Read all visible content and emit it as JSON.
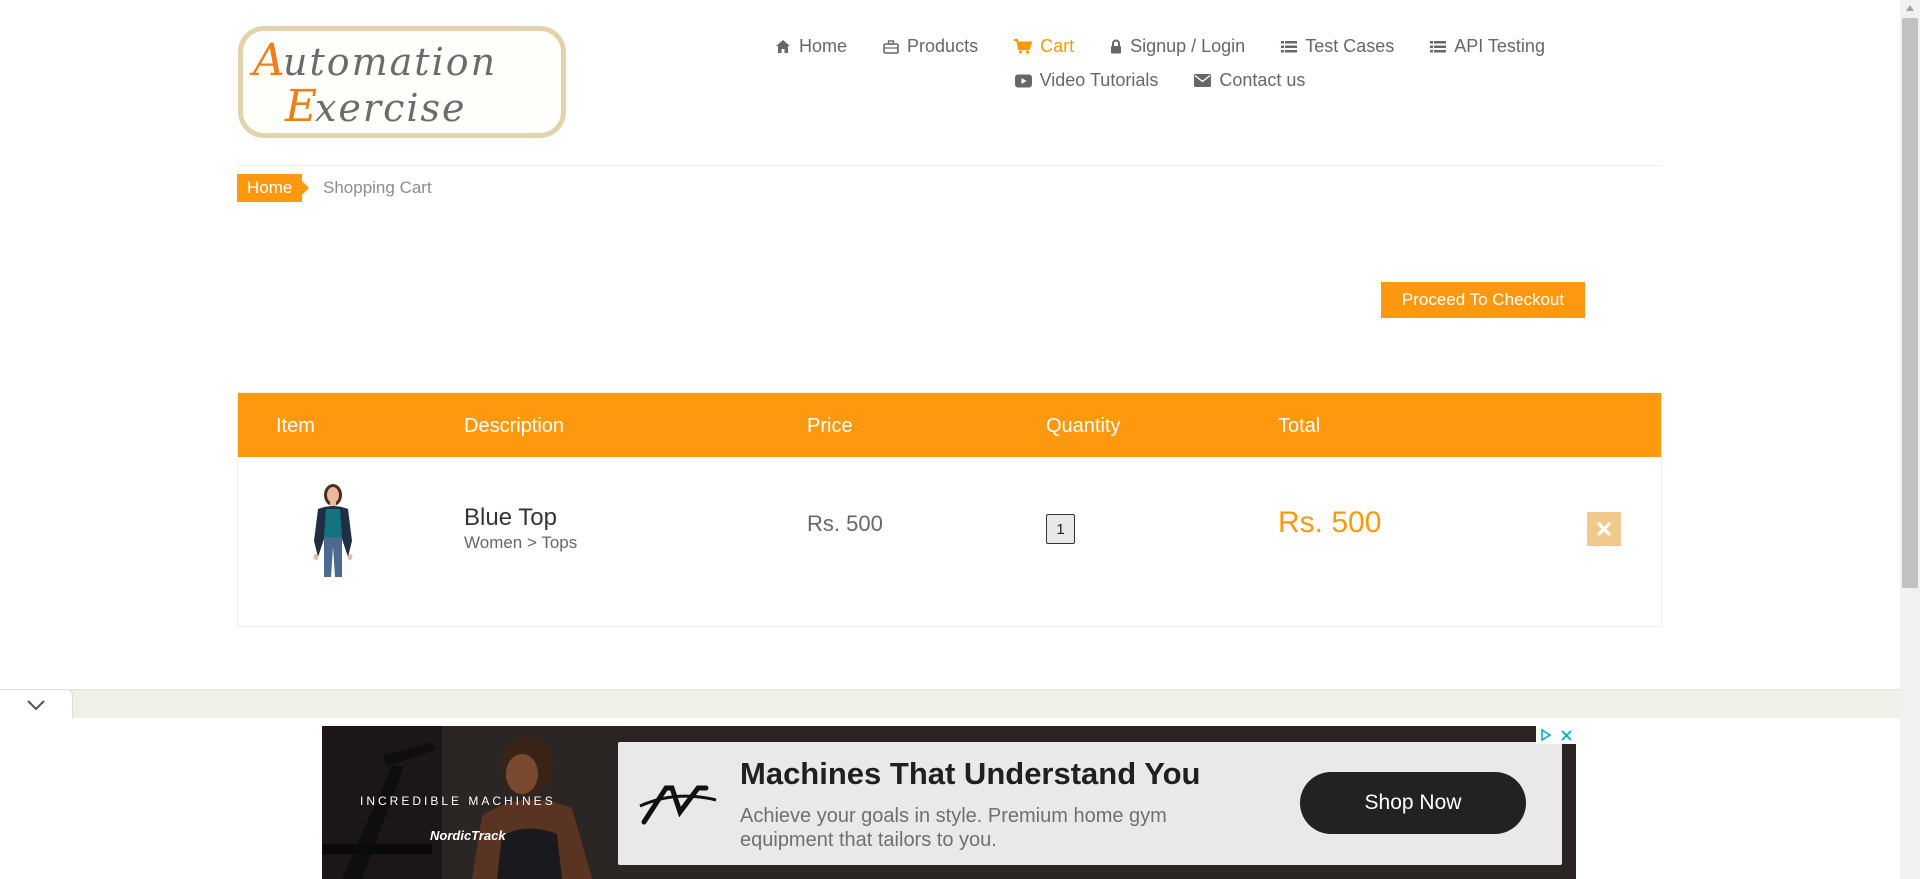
{
  "logo": {
    "line1": "Automation",
    "line2": "Exercise"
  },
  "nav": {
    "row1": [
      {
        "label": "Home",
        "icon": "home-icon"
      },
      {
        "label": "Products",
        "icon": "briefcase-icon"
      },
      {
        "label": "Cart",
        "icon": "cart-icon",
        "active": true
      },
      {
        "label": "Signup / Login",
        "icon": "lock-icon"
      },
      {
        "label": "Test Cases",
        "icon": "list-icon"
      },
      {
        "label": "API Testing",
        "icon": "list-icon"
      }
    ],
    "row2": [
      {
        "label": "Video Tutorials",
        "icon": "youtube-icon"
      },
      {
        "label": "Contact us",
        "icon": "envelope-icon"
      }
    ]
  },
  "breadcrumb": {
    "home": "Home",
    "current": "Shopping Cart"
  },
  "checkout_label": "Proceed To Checkout",
  "cart": {
    "headers": {
      "item": "Item",
      "description": "Description",
      "price": "Price",
      "quantity": "Quantity",
      "total": "Total"
    },
    "rows": [
      {
        "name": "Blue Top",
        "category": "Women > Tops",
        "price": "Rs. 500",
        "quantity": "1",
        "total": "Rs. 500"
      }
    ]
  },
  "ad": {
    "tagline": "INCREDIBLE MACHINES",
    "brand": "NordicTrack",
    "title": "Machines That Understand You",
    "description": "Achieve your goals in style. Premium home gym equipment that tailors to you.",
    "cta": "Shop Now"
  },
  "colors": {
    "accent": "#fe980f",
    "text": "#696763"
  }
}
